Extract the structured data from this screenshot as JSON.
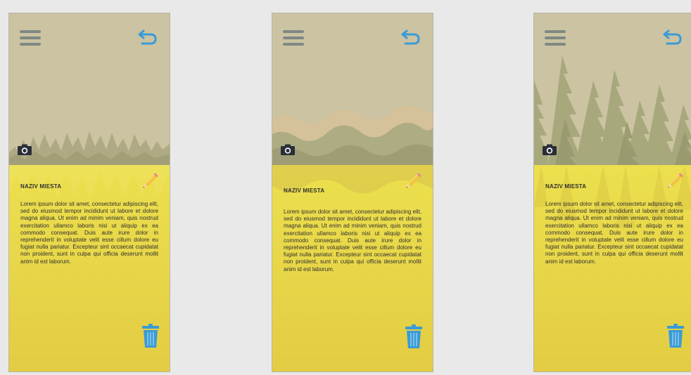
{
  "screens": [
    {
      "variant": "small-forest",
      "place_name": "NAZIV MIESTA",
      "description": "Lorem ipsum dolor sit amet, consectetur adipiscing elit, sed do eiusmod tempor incididunt ut labore et dolore magna aliqua. Ut enim ad minim veniam, quis nostrud exercitation ullamco laboris nisi ut aliquip ex ea commodo consequat. Duis aute irure dolor in reprehenderit in voluptate velit esse cillum dolore eu fugiat nulla pariatur. Excepteur sint occaecat cupidatat non proident, sunt in culpa qui officia deserunt mollit anim id est laborum."
    },
    {
      "variant": "waves",
      "place_name": "NAZIV MIESTA",
      "description": "Lorem ipsum dolor sit amet, consectetur adipiscing elit, sed do eiusmod tempor incididunt ut labore et dolore magna aliqua. Ut enim ad minim veniam, quis nostrud exercitation ullamco laboris nisi ut aliquip ex ea commodo consequat. Duis aute irure dolor in reprehenderit in voluptate velit esse cillum dolore eu fugiat nulla pariatur. Excepteur sint occaecat cupidatat non proident, sunt in culpa qui officia deserunt mollit anim id est laborum."
    },
    {
      "variant": "tall-forest",
      "place_name": "NAZIV MIESTA",
      "description": "Lorem ipsum dolor sit amet, consectetur adipiscing elit, sed do eiusmod tempor incididunt ut labore et dolore magna aliqua. Ut enim ad minim veniam, quis nostrud exercitation ullamco laboris nisi ut aliquip ex ea commodo consequat. Duis aute irure dolor in reprehenderit in voluptate velit esse cillum dolore eu fugiat nulla pariatur. Excepteur sint occaecat cupidatat non proident, sunt in culpa qui officia deserunt mollit anim id est laborum."
    }
  ],
  "icons": {
    "menu": "hamburger-icon",
    "back": "undo-arrow-icon",
    "camera": "camera-icon",
    "edit": "pencil-icon",
    "delete": "trash-icon"
  },
  "colors": {
    "background": "#e9e9e9",
    "hero": "#cbc3a2",
    "body": "#e6d04a",
    "accent_blue": "#3a9bd6",
    "menu_gray": "#7f8983",
    "text": "#2f2f2f"
  }
}
